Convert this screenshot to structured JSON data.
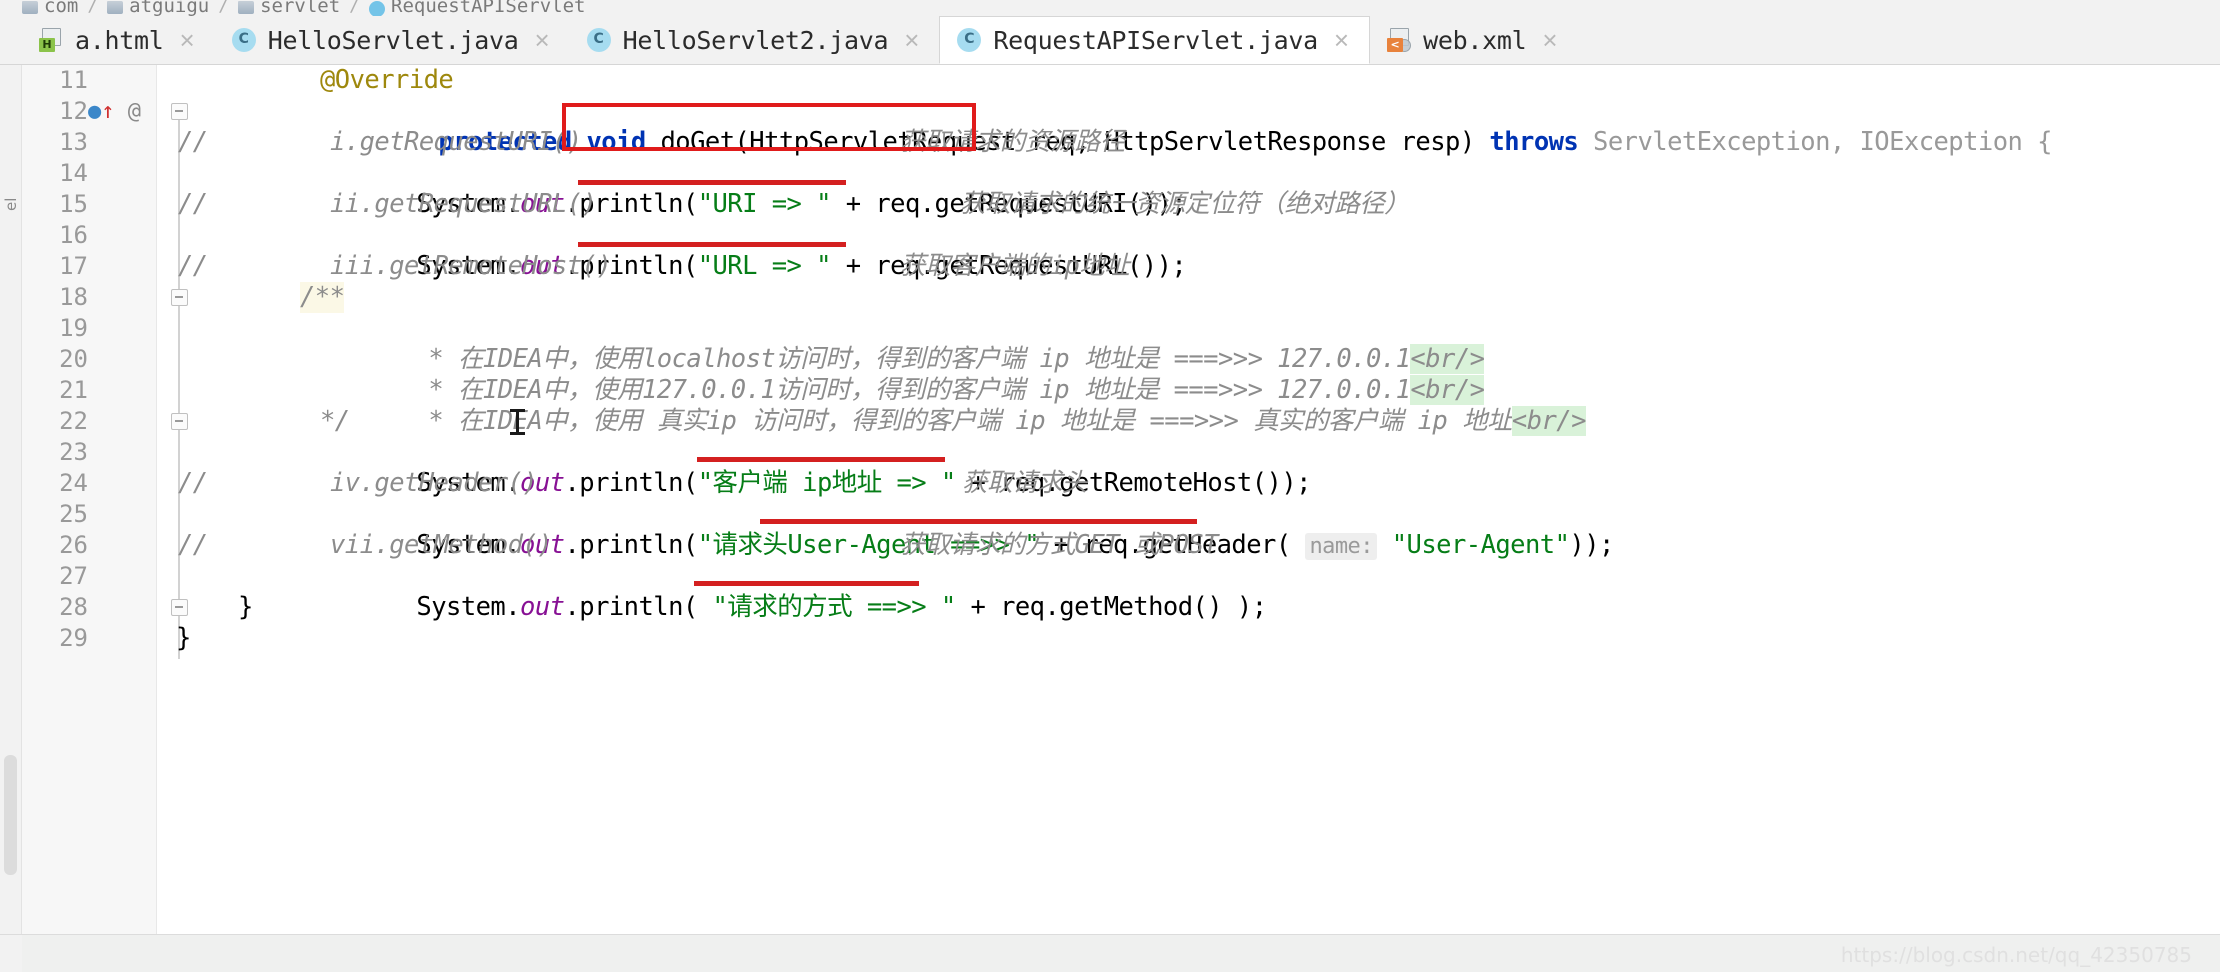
{
  "breadcrumb": {
    "items": [
      {
        "label": "com",
        "icon": "folder-icon"
      },
      {
        "label": "atguigu",
        "icon": "folder-icon"
      },
      {
        "label": "servlet",
        "icon": "folder-icon"
      },
      {
        "label": "RequestAPIServlet",
        "icon": "java-class-icon"
      }
    ],
    "separator": "/"
  },
  "tabs": [
    {
      "label": "a.html",
      "icon": "html-file-icon",
      "active": false,
      "close": "×"
    },
    {
      "label": "HelloServlet.java",
      "icon": "java-class-icon",
      "active": false,
      "close": "×"
    },
    {
      "label": "HelloServlet2.java",
      "icon": "java-class-icon",
      "active": false,
      "close": "×"
    },
    {
      "label": "RequestAPIServlet.java",
      "icon": "java-class-icon",
      "active": true,
      "close": "×"
    },
    {
      "label": "web.xml",
      "icon": "xml-file-icon",
      "active": false,
      "close": "×"
    }
  ],
  "left_strip": {
    "label": "el"
  },
  "editor": {
    "line_numbers": [
      "11",
      "12",
      "13",
      "14",
      "15",
      "16",
      "17",
      "18",
      "19",
      "20",
      "21",
      "22",
      "23",
      "24",
      "25",
      "26",
      "27",
      "28",
      "29"
    ],
    "lines": {
      "l11": {
        "n": "11",
        "text": "@Override"
      },
      "l12": {
        "n": "12",
        "t1": "protected",
        "t2": " void ",
        "t3": "doGet",
        "t4": "(HttpServletRequest req, HttpServletResponse resp) ",
        "t5": "throws",
        "t6": " ServletException, IOException {"
      },
      "l13": {
        "n": "13",
        "slash": "//",
        "code": "i.getRequestURI()",
        "note": "获取请求的资源路径"
      },
      "l14": {
        "n": "14",
        "a": "System.",
        "b": "out",
        "c": ".println(",
        "d": "\"URI => \"",
        "e": " + req.getRequestURI());"
      },
      "l15": {
        "n": "15",
        "slash": "//",
        "code": "ii.getRequestURL()",
        "note": "获取请求的统一资源定位符（绝对路径）"
      },
      "l16": {
        "n": "16",
        "a": "System.",
        "b": "out",
        "c": ".println(",
        "d": "\"URL => \"",
        "e": " + req.getRequestURL());"
      },
      "l17": {
        "n": "17",
        "slash": "//",
        "code": "iii.getRemoteHost()",
        "note": "获取客户端的ip地址"
      },
      "l18": {
        "n": "18",
        "text": "/**"
      },
      "l19": {
        "n": "19",
        "text": "* 在IDEA中，使用localhost访问时，得到的客户端 ip 地址是 ===>>> 127.0.0.1",
        "tag": "<br/>"
      },
      "l20": {
        "n": "20",
        "text": "* 在IDEA中，使用127.0.0.1访问时，得到的客户端 ip 地址是 ===>>> 127.0.0.1",
        "tag": "<br/>"
      },
      "l21": {
        "n": "21",
        "text": "* 在IDEA中，使用 真实ip 访问时，得到的客户端 ip 地址是 ===>>> 真实的客户端 ip 地址",
        "tag": "<br/>"
      },
      "l22": {
        "n": "22",
        "text": "*/"
      },
      "l23": {
        "n": "23",
        "a": "System.",
        "b": "out",
        "c": ".println(",
        "d": "\"客户端 ip地址 => \"",
        "e": " + req.getRemoteHost());"
      },
      "l24": {
        "n": "24",
        "slash": "//",
        "code": "iv.getHeader()",
        "note": "获取请求头"
      },
      "l25": {
        "n": "25",
        "a": "System.",
        "b": "out",
        "c": ".println(",
        "d": "\"请求头User-Agent ==>> \"",
        "e": " + req.getHeader( ",
        "hint": "name:",
        "f": " ",
        "g": "\"User-Agent\"",
        "h": "));"
      },
      "l26": {
        "n": "26",
        "slash": "//",
        "code": "vii.getMethod()",
        "note": "获取请求的方式GET 或POST"
      },
      "l27": {
        "n": "27",
        "a": "System.",
        "b": "out",
        "c": ".println( ",
        "d": "\"请求的方式 ==>> \"",
        "e": " + req.getMethod() );"
      },
      "l28": {
        "n": "28",
        "text": "}"
      },
      "l29": {
        "n": "29",
        "text": "}"
      }
    },
    "gutter_marks": {
      "line12": "●↑ @"
    }
  },
  "annotations": {
    "box_label": "red-highlight-box-around-HttpServletRequest-req",
    "underline_label": "red-underline"
  },
  "status": {
    "watermark": "https://blog.csdn.net/qq_42350785"
  },
  "colors": {
    "accent_red": "#d42020",
    "keyword_blue": "#0033b3",
    "string_green": "#067d17",
    "comment_gray": "#8c8c8c",
    "annotation_gold": "#9e880d",
    "field_purple": "#871094",
    "tab_active_bg": "#ffffff"
  }
}
